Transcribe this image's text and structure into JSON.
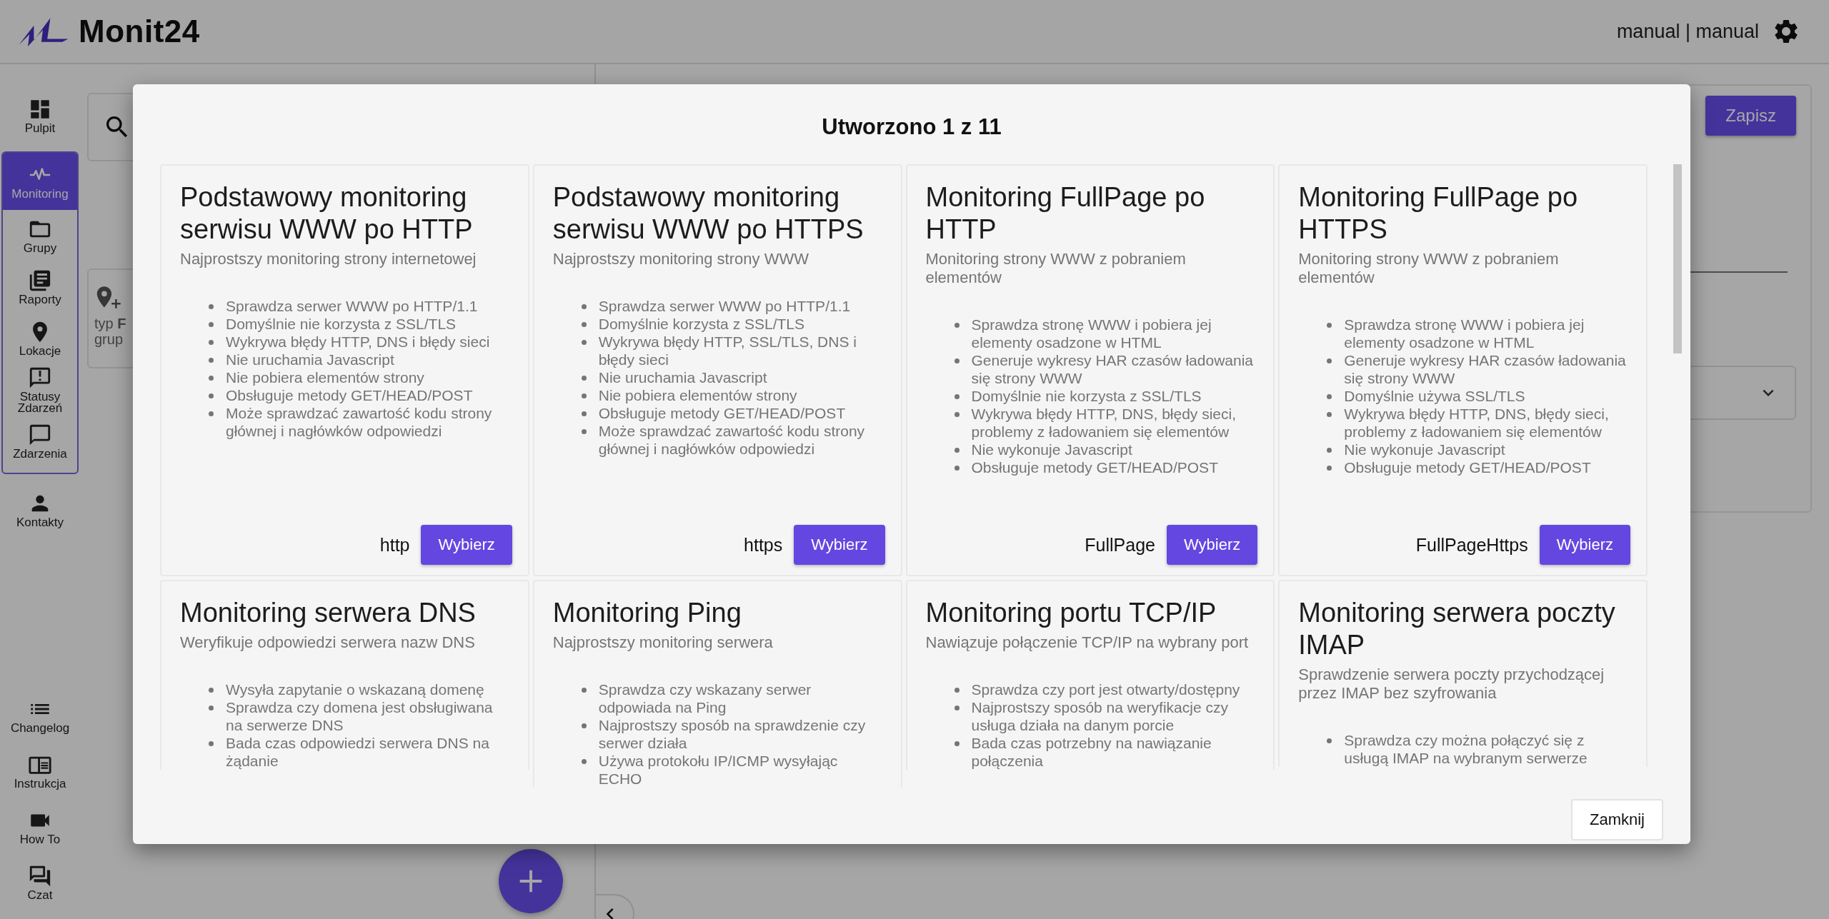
{
  "header": {
    "logo": "Monit24",
    "user": "manual | manual"
  },
  "sidebar": {
    "items": [
      {
        "label": "Pulpit",
        "selected": false
      },
      {
        "label": "Monitoring",
        "selected": true,
        "children": [
          {
            "label": "Grupy",
            "selected": false
          },
          {
            "label": "Raporty",
            "selected": false
          },
          {
            "label": "Lokacje",
            "selected": false
          },
          {
            "label": "Statusy Zdarzeń",
            "selected": false
          },
          {
            "label": "Zdarzenia",
            "selected": false
          }
        ]
      },
      {
        "label": "Kontakty",
        "selected": false
      }
    ],
    "footer_items": [
      {
        "label": "Changelog",
        "selected": false
      },
      {
        "label": "Instrukcja",
        "selected": false
      },
      {
        "label": "How To",
        "selected": false
      },
      {
        "label": "Czat",
        "selected": false
      }
    ]
  },
  "background": {
    "location_card": [
      "typ **F**",
      "grup"
    ],
    "save_button": "Zapisz"
  },
  "modal": {
    "title": "Utworzono 1 z 11",
    "cards": [
      {
        "title": "Podstawowy monitoring serwisu WWW po HTTP",
        "subtitle": "Najprostszy monitoring strony internetowej",
        "features": [
          "Sprawdza serwer WWW po HTTP/1.1",
          "Domyślnie nie korzysta z SSL/TLS",
          "Wykrywa błędy HTTP, DNS i błędy sieci",
          "Nie uruchamia Javascript",
          "Nie pobiera elementów strony",
          "Obsługuje metody GET/HEAD/POST",
          "Może sprawdzać zawartość kodu strony głównej i nagłówków odpowiedzi"
        ],
        "type_label": "http",
        "button": "Wybierz"
      },
      {
        "title": "Podstawowy monitoring serwisu WWW po HTTPS",
        "subtitle": "Najprostszy monitoring strony WWW",
        "features": [
          "Sprawdza serwer WWW po HTTP/1.1",
          "Domyślnie korzysta z SSL/TLS",
          "Wykrywa błędy HTTP, SSL/TLS, DNS i błędy sieci",
          "Nie uruchamia Javascript",
          "Nie pobiera elementów strony",
          "Obsługuje metody GET/HEAD/POST",
          "Może sprawdzać zawartość kodu strony głównej i nagłówków odpowiedzi"
        ],
        "type_label": "https",
        "button": "Wybierz"
      },
      {
        "title": "Monitoring FullPage po HTTP",
        "subtitle": "Monitoring strony WWW z pobraniem elementów",
        "features": [
          "Sprawdza stronę WWW i pobiera jej elementy osadzone w HTML",
          "Generuje wykresy HAR czasów ładowania się strony WWW",
          "Domyślnie nie korzysta z SSL/TLS",
          "Wykrywa błędy HTTP, DNS, błędy sieci, problemy z ładowaniem się elementów",
          "Nie wykonuje Javascript",
          "Obsługuje metody GET/HEAD/POST"
        ],
        "type_label": "FullPage",
        "button": "Wybierz"
      },
      {
        "title": "Monitoring FullPage po HTTPS",
        "subtitle": "Monitoring strony WWW z pobraniem elementów",
        "features": [
          "Sprawdza stronę WWW i pobiera jej elementy osadzone w HTML",
          "Generuje wykresy HAR czasów ładowania się strony WWW",
          "Domyślnie używa SSL/TLS",
          "Wykrywa błędy HTTP, DNS, błędy sieci, problemy z ładowaniem się elementów",
          "Nie wykonuje Javascript",
          "Obsługuje metody GET/HEAD/POST"
        ],
        "type_label": "FullPageHttps",
        "button": "Wybierz"
      },
      {
        "title": "Monitoring serwera DNS",
        "subtitle": "Weryfikuje odpowiedzi serwera nazw DNS",
        "features": [
          "Wysyła zapytanie o wskazaną domenę",
          "Sprawdza czy domena jest obsługiwana na serwerze DNS",
          "Bada czas odpowiedzi serwera DNS na żądanie"
        ]
      },
      {
        "title": "Monitoring Ping",
        "subtitle": "Najprostszy monitoring serwera",
        "features": [
          "Sprawdza czy wskazany serwer odpowiada na Ping",
          "Najprostszy sposób na sprawdzenie czy serwer działa",
          "Używa protokołu IP/ICMP wysyłając ECHO"
        ]
      },
      {
        "title": "Monitoring portu TCP/IP",
        "subtitle": "Nawiązuje połączenie TCP/IP na wybrany port",
        "features": [
          "Sprawdza czy port jest otwarty/dostępny",
          "Najprostszy sposób na weryfikacje czy usługa działa na danym porcie",
          "Bada czas potrzebny na nawiązanie połączenia"
        ]
      },
      {
        "title": "Monitoring serwera poczty IMAP",
        "subtitle": "Sprawdzenie serwera poczty przychodzącej przez IMAP bez szyfrowania",
        "features": [
          "Sprawdza czy można połączyć się z usługą IMAP na wybranym serwerze"
        ]
      }
    ],
    "close_button": "Zamknij"
  }
}
